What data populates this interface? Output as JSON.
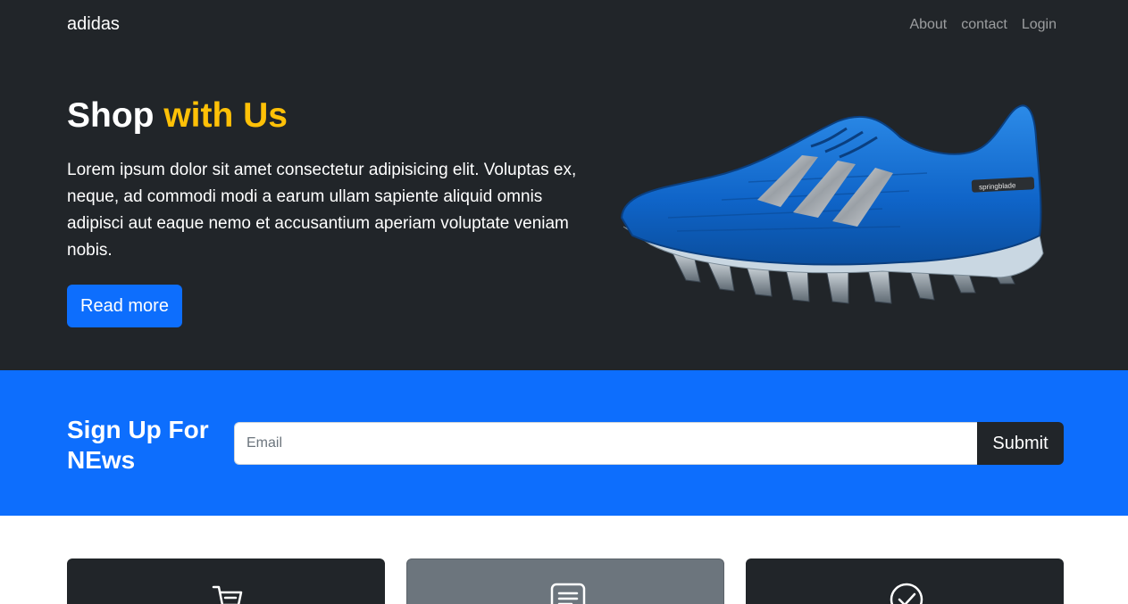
{
  "navbar": {
    "brand": "adidas",
    "links": [
      "About",
      "contact",
      "Login"
    ]
  },
  "hero": {
    "title_plain": "Shop",
    "title_accent": "with Us",
    "text": "Lorem ipsum dolor sit amet consectetur adipisicing elit. Voluptas ex, neque, ad commodi modi a earum ullam sapiente aliquid omnis adipisci aut eaque nemo et accusantium aperiam voluptate veniam nobis.",
    "button_label": "Read more",
    "image_alt": "blue adidas springblade running shoe",
    "shoe_label": "springblade"
  },
  "signup": {
    "title": "Sign Up For NEws",
    "email_placeholder": "Email",
    "submit_label": "Submit"
  },
  "cards": [
    {
      "icon": "cart-icon"
    },
    {
      "icon": "document-icon"
    },
    {
      "icon": "check-circle-icon"
    }
  ],
  "colors": {
    "dark": "#212529",
    "primary": "#0d6efd",
    "accent": "#ffc107",
    "gray": "#6c757d"
  }
}
